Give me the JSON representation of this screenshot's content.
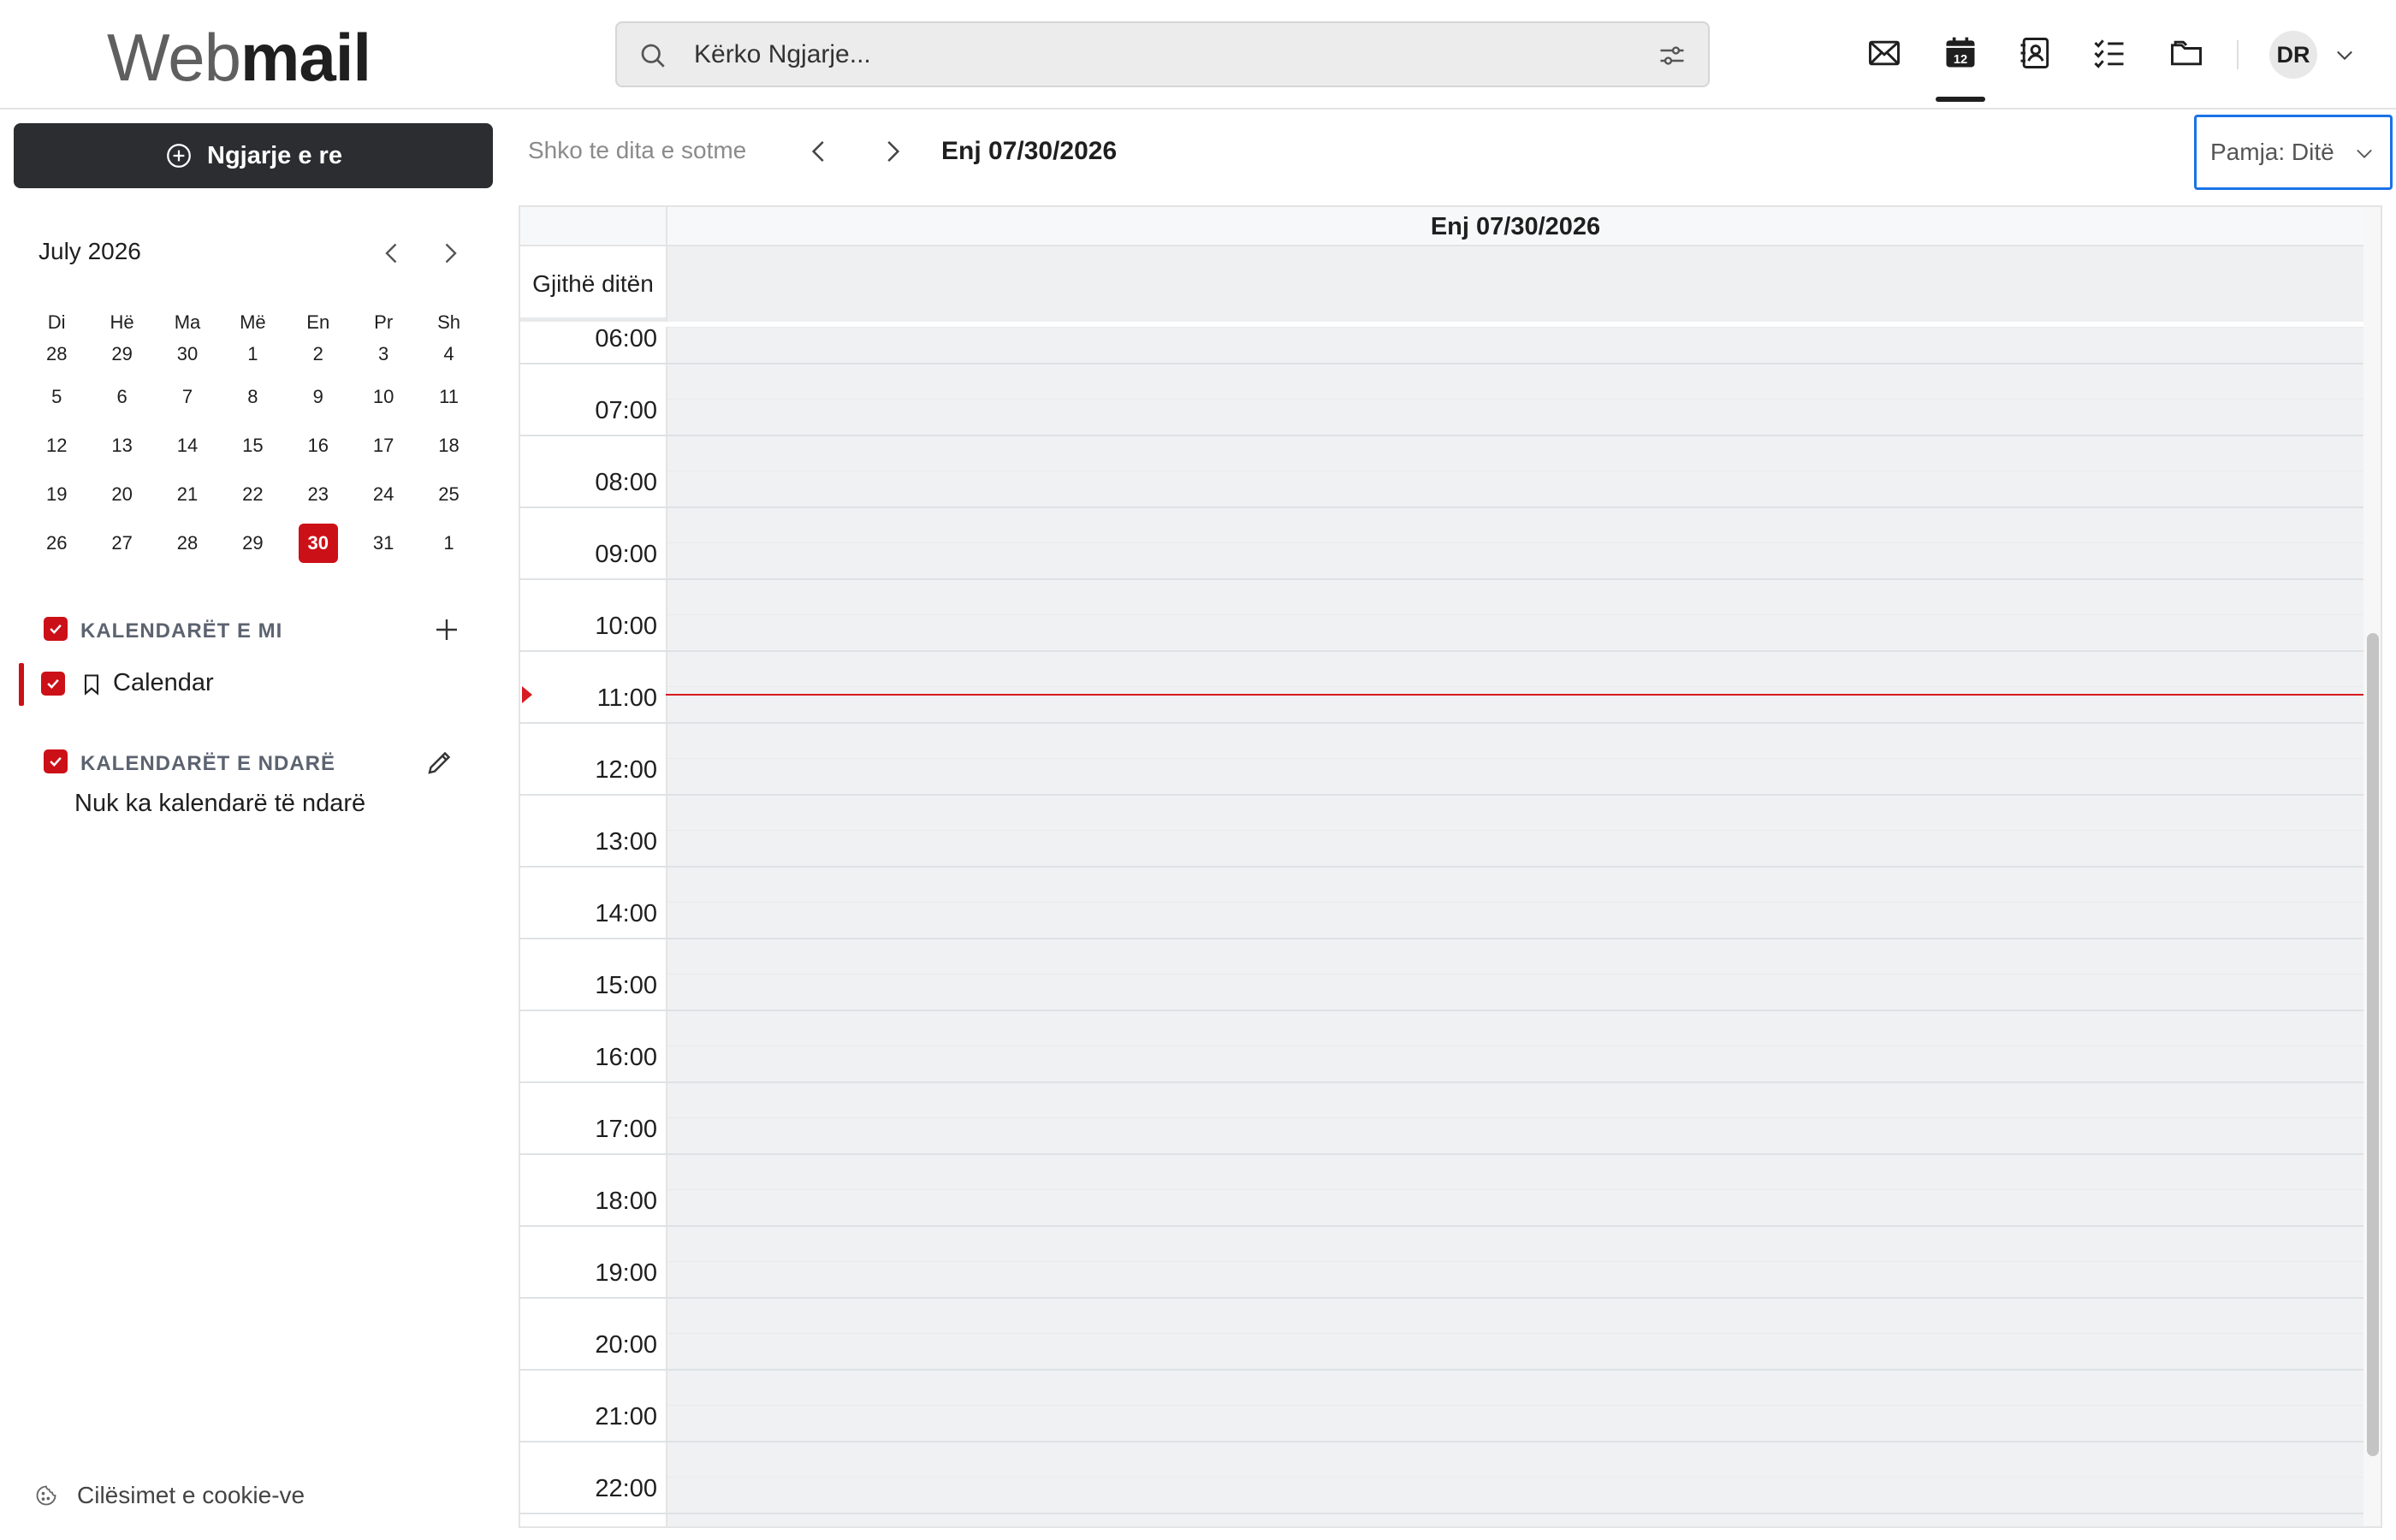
{
  "header": {
    "logo_light": "Web",
    "logo_bold": "mail",
    "search_placeholder": "Kërko Ngjarje...",
    "nav": [
      {
        "name": "mail",
        "icon": "mail-icon"
      },
      {
        "name": "calendar",
        "icon": "calendar-icon",
        "badge": "12",
        "active": true
      },
      {
        "name": "contacts",
        "icon": "contacts-icon"
      },
      {
        "name": "tasks",
        "icon": "tasks-icon"
      },
      {
        "name": "files",
        "icon": "folder-icon"
      }
    ],
    "avatar_initials": "DR"
  },
  "sidebar": {
    "new_event_label": "Ngjarje e re",
    "mini_calendar": {
      "title": "July 2026",
      "weekdays": [
        "Di",
        "Hë",
        "Ma",
        "Më",
        "En",
        "Pr",
        "Sh"
      ],
      "weeks": [
        [
          "28",
          "29",
          "30",
          "1",
          "2",
          "3",
          "4"
        ],
        [
          "5",
          "6",
          "7",
          "8",
          "9",
          "10",
          "11"
        ],
        [
          "12",
          "13",
          "14",
          "15",
          "16",
          "17",
          "18"
        ],
        [
          "19",
          "20",
          "21",
          "22",
          "23",
          "24",
          "25"
        ],
        [
          "26",
          "27",
          "28",
          "29",
          "30",
          "31",
          "1"
        ]
      ],
      "today": "30"
    },
    "my_calendars_title": "KALENDARËT E MI",
    "calendar_item": "Calendar",
    "shared_calendars_title": "KALENDARËT E NDARË",
    "no_shared_text": "Nuk ka kalendarë të ndarë",
    "cookie_label": "Cilësimet e cookie-ve"
  },
  "toolbar": {
    "today_label": "Shko te dita e sotme",
    "current_date": "Enj 07/30/2026",
    "view_label": "Pamja: Ditë"
  },
  "dayview": {
    "column_date": "Enj 07/30/2026",
    "all_day_label": "Gjithë ditën",
    "hours": [
      "06:00",
      "07:00",
      "08:00",
      "09:00",
      "10:00",
      "11:00",
      "12:00",
      "13:00",
      "14:00",
      "15:00",
      "16:00",
      "17:00",
      "18:00",
      "19:00",
      "20:00",
      "21:00",
      "22:00"
    ],
    "now_time": "11:00"
  },
  "colors": {
    "accent": "#cc1018",
    "now_line": "#d81b20",
    "focus": "#1a73e8",
    "dark_button": "#2b2d30"
  }
}
